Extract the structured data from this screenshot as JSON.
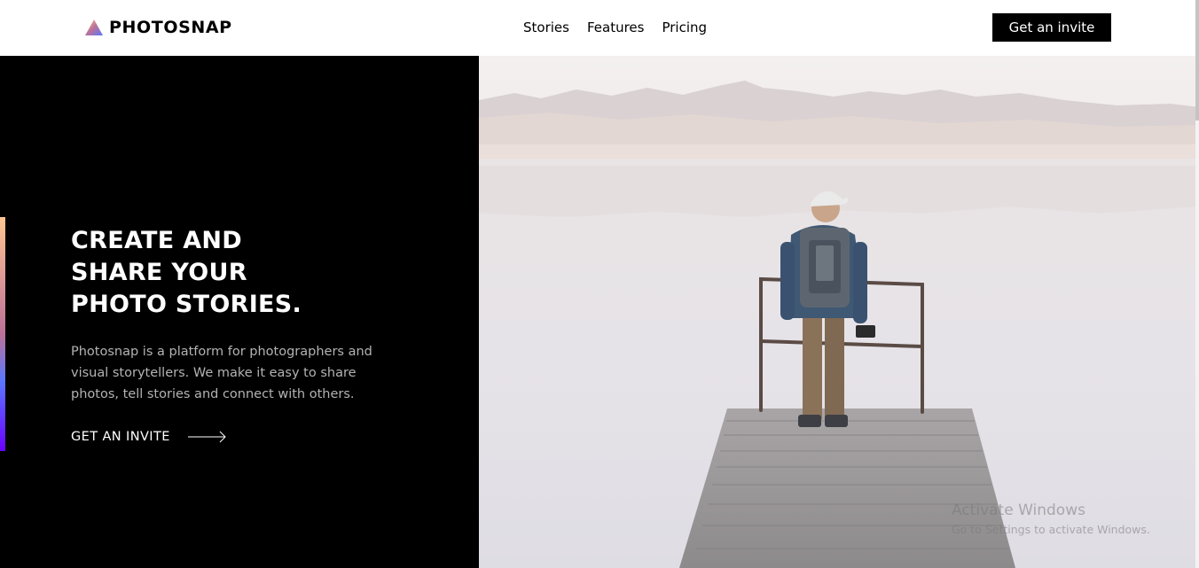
{
  "brand": {
    "name": "PHOTOSNAP",
    "logo_icon": "gradient-triangle-icon"
  },
  "nav": {
    "items": [
      {
        "label": "Stories"
      },
      {
        "label": "Features"
      },
      {
        "label": "Pricing"
      }
    ]
  },
  "header": {
    "invite_button": "Get an invite"
  },
  "hero": {
    "title_lines": [
      "CREATE AND",
      "SHARE YOUR",
      "PHOTO STORIES."
    ],
    "description": "Photosnap is a platform for photographers and visual storytellers. We make it easy to share photos, tell stories and connect with others.",
    "cta_label": "GET AN INVITE",
    "cta_icon": "arrow-right-icon",
    "accent_gradient": [
      "#FFC593",
      "#BC7198",
      "#5A77FF",
      "#6B00FF"
    ]
  },
  "colors": {
    "background_dark": "#000000",
    "text_light": "#ffffff",
    "text_muted": "#b3b3b3"
  },
  "system_overlay": {
    "title": "Activate Windows",
    "subtitle": "Go to Settings to activate Windows."
  }
}
